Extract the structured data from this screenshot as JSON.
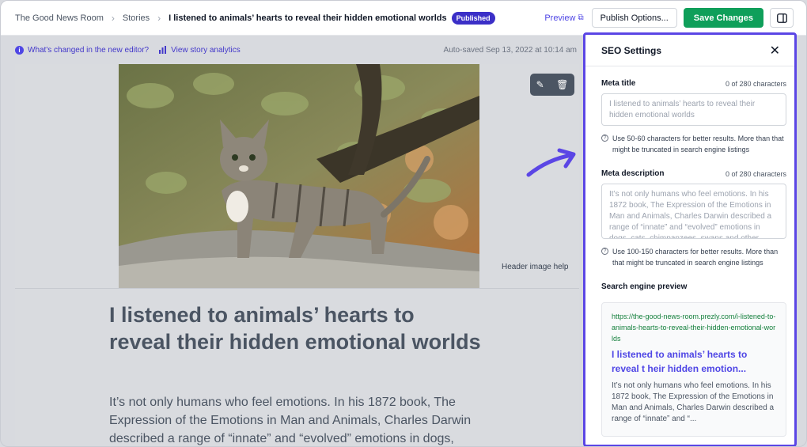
{
  "breadcrumb": {
    "root": "The Good News Room",
    "section": "Stories",
    "current": "I listened to animals’ hearts to reveal their hidden emotional worlds",
    "status": "Published"
  },
  "toolbar": {
    "preview_label": "Preview",
    "publish_options_label": "Publish Options...",
    "save_label": "Save Changes"
  },
  "subbar": {
    "whats_changed": "What's changed in the new editor?",
    "analytics": "View story analytics",
    "autosave": "Auto-saved Sep 13, 2022 at 10:14 am"
  },
  "editor": {
    "header_image_help": "Header image help",
    "title": "I listened to animals’ hearts to reveal their hidden emotional worlds",
    "body": "It’s not only humans who feel emotions. In his 1872 book, The Expression of the Emotions in Man and Animals, Charles Darwin described a range of “innate” and “evolved” emotions in dogs,"
  },
  "seo": {
    "title": "SEO Settings",
    "meta_title": {
      "label": "Meta title",
      "count": "0 of 280 characters",
      "placeholder": "I listened to animals’ hearts to reveal their hidden emotional worlds",
      "hint": "Use 50-60 characters for better results. More than that might be truncated in search engine listings"
    },
    "meta_description": {
      "label": "Meta description",
      "count": "0 of 280 characters",
      "placeholder": "It’s not only humans who feel emotions. In his 1872 book, The Expression of the Emotions in Man and Animals, Charles Darwin described a range of “innate” and “evolved” emotions in dogs, cats, chimpanzees, swans and other",
      "hint": "Use 100-150 characters for better results. More than that might be truncated in search engine listings"
    },
    "preview": {
      "label": "Search engine preview",
      "url": "https://the-good-news-room.prezly.com/i-listened-to-animals-hearts-to-reveal-their-hidden-emotional-worlds",
      "title": "I listened to animals’ hearts to reveal t heir hidden emotion...",
      "description": "It’s not only humans who feel emotions. In his 1872 book, The Expression of the Emotions in Man and Animals, Charles Darwin described a range of “innate” and “..."
    }
  },
  "colors": {
    "accent": "#5b46e5",
    "save": "#0f9f5a",
    "badge": "#3b2fc7"
  }
}
